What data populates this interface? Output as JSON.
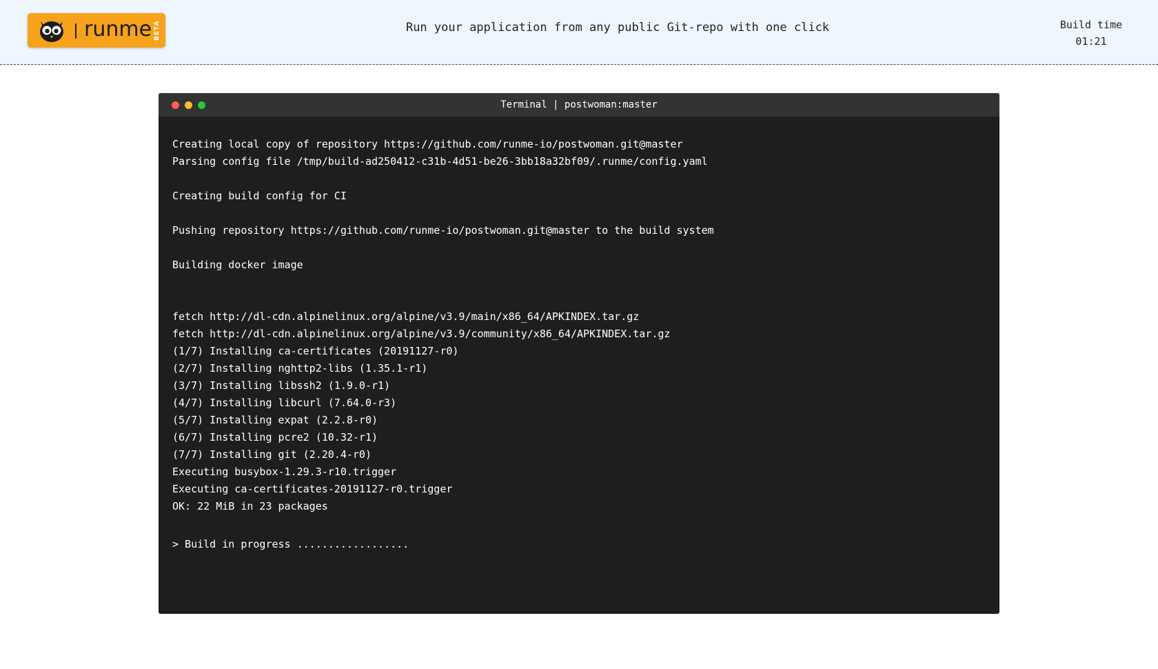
{
  "header": {
    "logo_text": "runme",
    "logo_badge": "BETA",
    "tagline": "Run your application from any public Git-repo with one click",
    "build_time_label": "Build time",
    "build_time_value": "01:21"
  },
  "colors": {
    "header_bg": "#eef6ff",
    "logo_bg": "#f7a21b",
    "terminal_bg": "#1e1e1e",
    "terminal_titlebar": "#333333",
    "dot_red": "#ff5f57",
    "dot_yellow": "#febc2e",
    "dot_green": "#28c840"
  },
  "icons": {
    "logo": "owl-icon",
    "window_controls": [
      "close-dot-icon",
      "minimize-dot-icon",
      "maximize-dot-icon"
    ]
  },
  "terminal": {
    "title": "Terminal | postwoman:master",
    "lines": [
      "Creating local copy of repository https://github.com/runme-io/postwoman.git@master",
      "Parsing config file /tmp/build-ad250412-c31b-4d51-be26-3bb18a32bf09/.runme/config.yaml",
      "Creating build config for CI",
      "Pushing repository https://github.com/runme-io/postwoman.git@master to the build system",
      "Building docker image",
      "fetch http://dl-cdn.alpinelinux.org/alpine/v3.9/main/x86_64/APKINDEX.tar.gz",
      "fetch http://dl-cdn.alpinelinux.org/alpine/v3.9/community/x86_64/APKINDEX.tar.gz",
      "(1/7) Installing ca-certificates (20191127-r0)",
      "(2/7) Installing nghttp2-libs (1.35.1-r1)",
      "(3/7) Installing libssh2 (1.9.0-r1)",
      "(4/7) Installing libcurl (7.64.0-r3)",
      "(5/7) Installing expat (2.2.8-r0)",
      "(6/7) Installing pcre2 (10.32-r1)",
      "(7/7) Installing git (2.20.4-r0)",
      "Executing busybox-1.29.3-r10.trigger",
      "Executing ca-certificates-20191127-r0.trigger",
      "OK: 22 MiB in 23 packages"
    ],
    "prompt": "> Build in progress .................."
  }
}
